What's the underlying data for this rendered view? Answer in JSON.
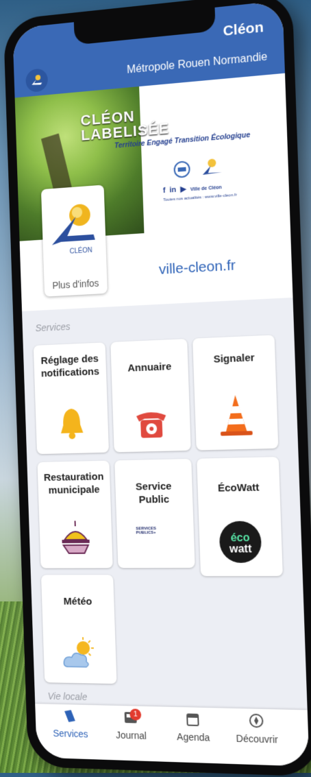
{
  "appbar": {
    "city": "Cléon",
    "metro": "Métropole Rouen Normandie"
  },
  "banner": {
    "headline_1": "CLÉON",
    "headline_2": "LABELISÉE",
    "tagline": "Territoire Engagé Transition Écologique",
    "socials_name": "Ville de Cléon",
    "socials_note": "Toutes nos actualités : www.ville-cleon.fr",
    "more_info": "Plus d'infos",
    "logo_text": "CLÉON",
    "website": "ville-cleon.fr"
  },
  "services_title": "Services",
  "tiles": [
    {
      "label": "Réglage des notifications",
      "icon": "bell-icon"
    },
    {
      "label": "Annuaire",
      "icon": "phone-icon"
    },
    {
      "label": "Signaler",
      "icon": "traffic-cone-icon"
    },
    {
      "label": "Restauration municipale",
      "icon": "cloche-tray-icon"
    },
    {
      "label": "Service Public",
      "icon": "services-publics-logo"
    },
    {
      "label": "ÉcoWatt",
      "icon": "ecowatt-logo",
      "logo_text_1": "éco",
      "logo_text_2": "watt"
    },
    {
      "label": "Météo",
      "icon": "sun-cloud-icon"
    }
  ],
  "service_public_logo_text": "SERVICES PUBLICS+",
  "vie_locale_title": "Vie locale",
  "nav": [
    {
      "label": "Services",
      "icon": "services-icon",
      "active": true
    },
    {
      "label": "Journal",
      "icon": "newspaper-icon",
      "badge": "1"
    },
    {
      "label": "Agenda",
      "icon": "calendar-icon"
    },
    {
      "label": "Découvrir",
      "icon": "compass-icon"
    }
  ],
  "colors": {
    "primary": "#3a69b6",
    "link": "#2d62b7",
    "badge": "#e23b2e"
  }
}
